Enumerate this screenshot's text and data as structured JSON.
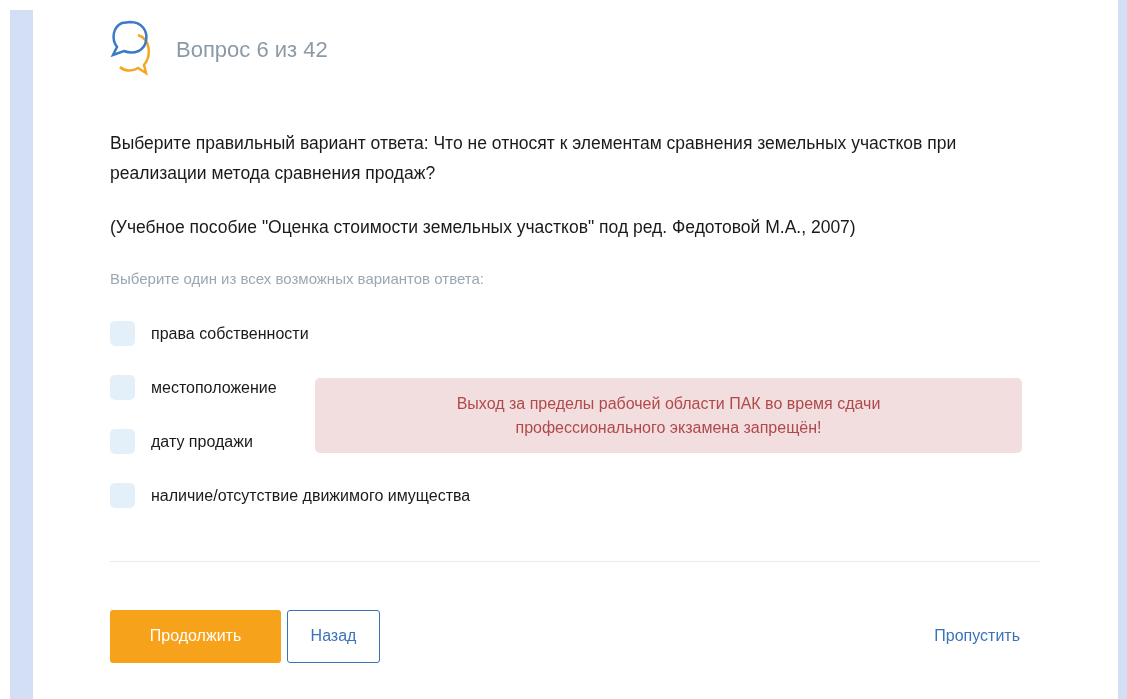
{
  "header": {
    "counter": "Вопрос 6 из 42"
  },
  "question": {
    "text": "Выберите правильный вариант ответа: Что не относят к элементам сравнения земельных участков при реализации метода сравнения продаж?",
    "source": "(Учебное пособие \"Оценка стоимости земельных участков\" под ред. Федотовой М.А., 2007)"
  },
  "instruction": "Выберите один из всех возможных вариантов ответа:",
  "options": [
    {
      "label": "права собственности",
      "checked": false
    },
    {
      "label": "местоположение",
      "checked": false
    },
    {
      "label": "дату продажи",
      "checked": false
    },
    {
      "label": "наличие/отсутствие движимого имущества",
      "checked": false
    }
  ],
  "alert": {
    "text": "Выход за пределы рабочей области ПАК во время сдачи профессионального экзамена запрещён!"
  },
  "buttons": {
    "continue": "Продолжить",
    "back": "Назад",
    "skip": "Пропустить"
  }
}
